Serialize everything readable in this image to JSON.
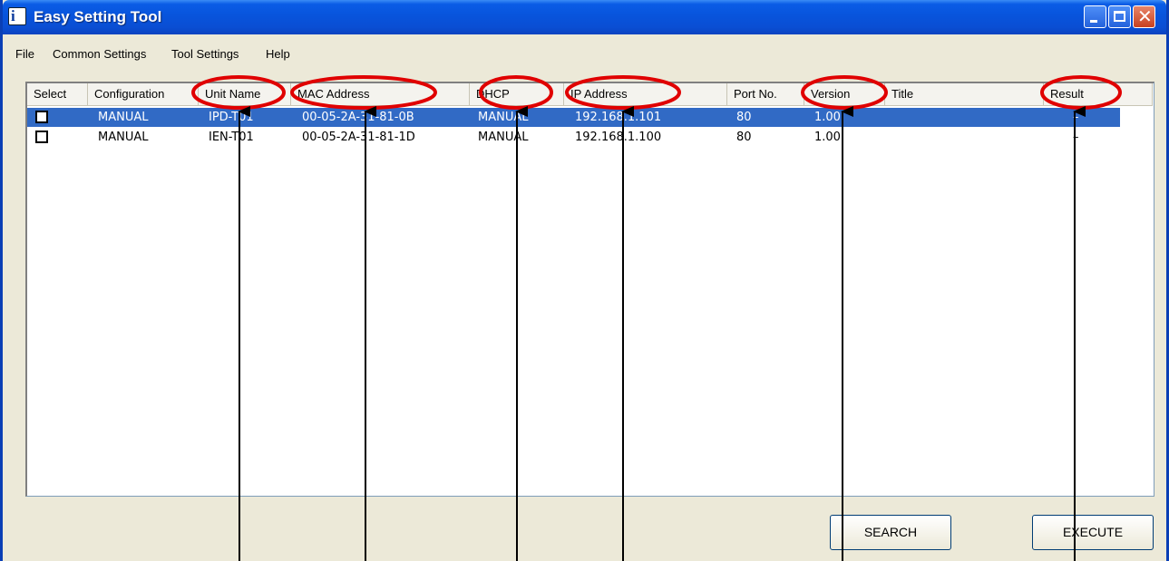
{
  "window": {
    "title": "Easy Setting Tool",
    "app_icon_glyph": "i",
    "controls": {
      "minimize_icon": "minimize-icon",
      "maximize_icon": "maximize-icon",
      "close_icon": "close-icon",
      "close_glyph": "✕"
    }
  },
  "menu": {
    "file": "File",
    "common_settings": "Common Settings",
    "tool_settings": "Tool Settings",
    "help": "Help"
  },
  "columns": {
    "select": "Select",
    "configuration": "Configuration",
    "unit_name": "Unit Name",
    "mac_address": "MAC Address",
    "dhcp": "DHCP",
    "ip_address": "IP Address",
    "port_no": "Port No.",
    "version": "Version",
    "title": "Title",
    "result": "Result"
  },
  "rows": [
    {
      "selected": true,
      "configuration": "MANUAL",
      "unit_name": "IPD-T01",
      "mac_address": "00-05-2A-31-81-0B",
      "dhcp": "MANUAL",
      "ip_address": "192.168.1.101",
      "port_no": "80",
      "version": "1.00",
      "title": "",
      "result": "–"
    },
    {
      "selected": false,
      "configuration": "MANUAL",
      "unit_name": "IEN-T01",
      "mac_address": "00-05-2A-31-81-1D",
      "dhcp": "MANUAL",
      "ip_address": "192.168.1.100",
      "port_no": "80",
      "version": "1.00",
      "title": "",
      "result": "–"
    }
  ],
  "buttons": {
    "search": "SEARCH",
    "execute": "EXECUTE"
  },
  "colors": {
    "title_bar": "#0a5ce6",
    "selection": "#316ac5",
    "annotation": "#e00000"
  }
}
